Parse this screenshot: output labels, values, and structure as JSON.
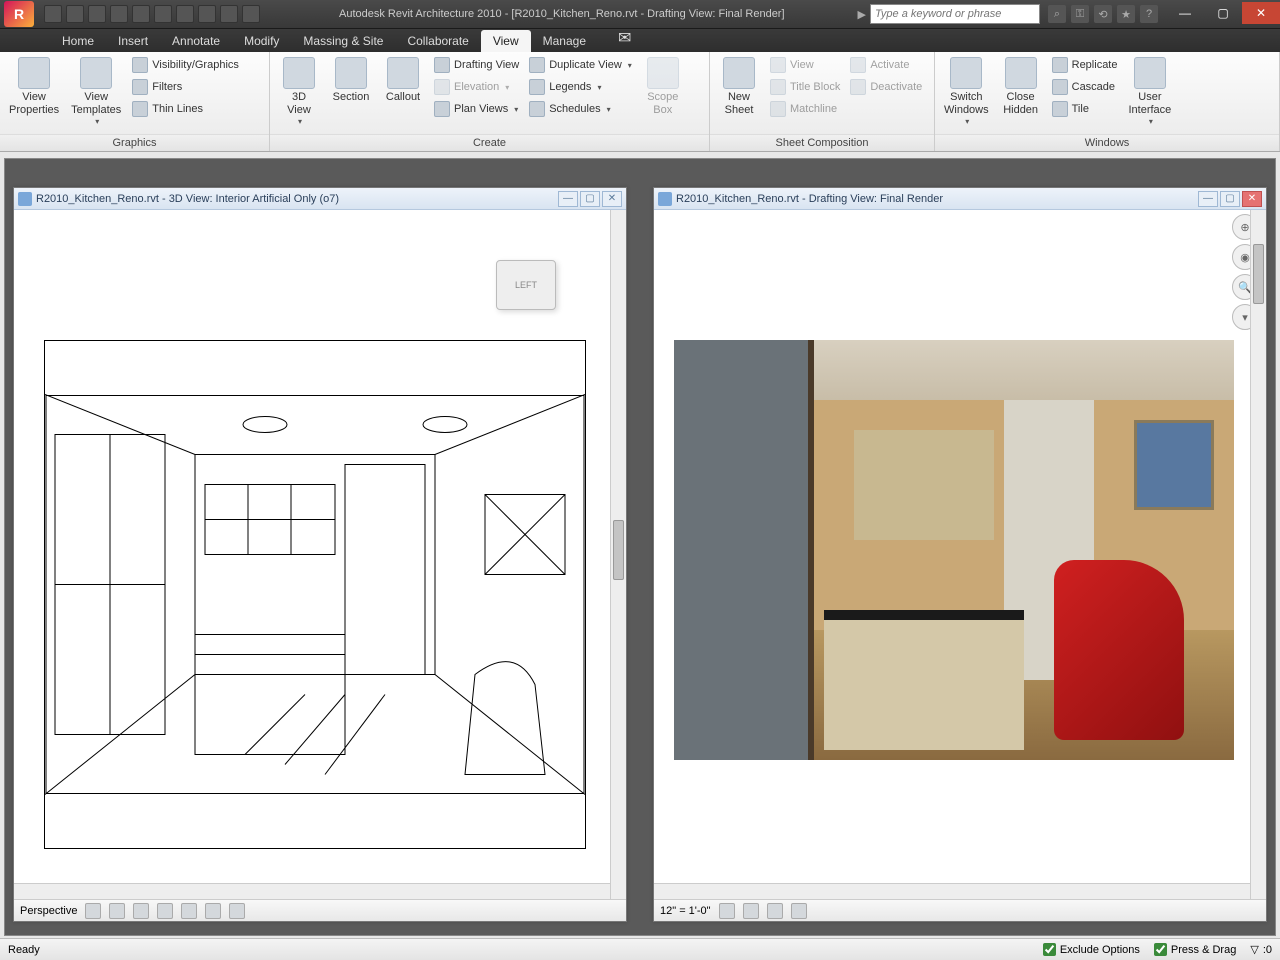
{
  "app": {
    "title": "Autodesk Revit Architecture 2010 - [R2010_Kitchen_Reno.rvt - Drafting View: Final Render]",
    "search_placeholder": "Type a keyword or phrase",
    "logo_letter": "R"
  },
  "tabs": {
    "home": "Home",
    "insert": "Insert",
    "annotate": "Annotate",
    "modify": "Modify",
    "massing": "Massing & Site",
    "collaborate": "Collaborate",
    "view": "View",
    "manage": "Manage"
  },
  "ribbon": {
    "graphics": {
      "label": "Graphics",
      "view_props": "View\nProperties",
      "view_templates": "View\nTemplates",
      "visibility": "Visibility/Graphics",
      "filters": "Filters",
      "thin_lines": "Thin Lines"
    },
    "create": {
      "label": "Create",
      "view3d": "3D\nView",
      "section": "Section",
      "callout": "Callout",
      "drafting": "Drafting View",
      "elevation": "Elevation",
      "plan": "Plan Views",
      "duplicate": "Duplicate View",
      "legends": "Legends",
      "schedules": "Schedules",
      "scope": "Scope\nBox"
    },
    "sheet": {
      "label": "Sheet Composition",
      "new_sheet": "New\nSheet",
      "view": "View",
      "title_block": "Title Block",
      "matchline": "Matchline",
      "activate": "Activate",
      "deactivate": "Deactivate"
    },
    "windows": {
      "label": "Windows",
      "switch": "Switch\nWindows",
      "close_hidden": "Close\nHidden",
      "replicate": "Replicate",
      "cascade": "Cascade",
      "tile": "Tile",
      "ui": "User\nInterface"
    }
  },
  "doc_left": {
    "title": "R2010_Kitchen_Reno.rvt - 3D View: Interior Artificial Only (o7)",
    "viewcube": "LEFT",
    "mode": "Perspective"
  },
  "doc_right": {
    "title": "R2010_Kitchen_Reno.rvt - Drafting View: Final Render",
    "scale": "12\" = 1'-0\""
  },
  "status": {
    "ready": "Ready",
    "exclude": "Exclude Options",
    "press_drag": "Press & Drag",
    "filter_count": ":0"
  }
}
